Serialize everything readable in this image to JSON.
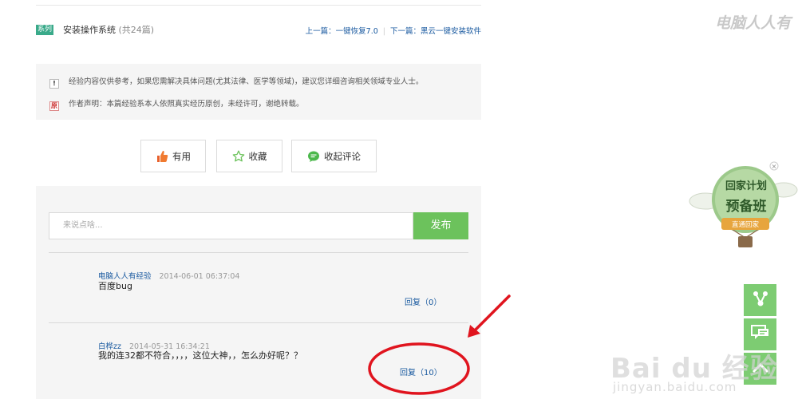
{
  "series": {
    "tag": "系列",
    "title": "安装操作系统",
    "count": "(共24篇)",
    "prev": "上一篇：一键恢复7.0",
    "next": "下一篇：黑云一键安装软件"
  },
  "notice": {
    "icon1": "!",
    "line1": "经验内容仅供参考，如果您需解决具体问题(尤其法律、医学等领域)，建议您详细咨询相关领域专业人士。",
    "icon2": "原",
    "line2": "作者声明：本篇经验系本人依照真实经历原创，未经许可，谢绝转载。"
  },
  "actions": {
    "useful": "有用",
    "favorite": "收藏",
    "comments": "收起评论"
  },
  "comment_form": {
    "placeholder": "来说点啥...",
    "post": "发布"
  },
  "comments": [
    {
      "user": "电脑人人有经验",
      "time": "2014-06-01 06:37:04",
      "text": "百度bug",
      "reply": "回复（0）"
    },
    {
      "user": "白桦zz",
      "time": "2014-05-31 16:34:21",
      "text": "我的连32都不符合，，，，这位大神，，怎么办好呢？？",
      "reply": "回复（10）"
    }
  ],
  "ad": {
    "line1": "回家计划",
    "line2": "预备班",
    "ribbon": "直通回家"
  },
  "watermarks": {
    "top_right": "电脑人人有",
    "brand": "Bai du 经验",
    "url": "jingyan.baidu.com"
  },
  "colors": {
    "accent_green": "#6cc25c",
    "link_blue": "#1a5aa0",
    "annotation_red": "#e0141e"
  }
}
